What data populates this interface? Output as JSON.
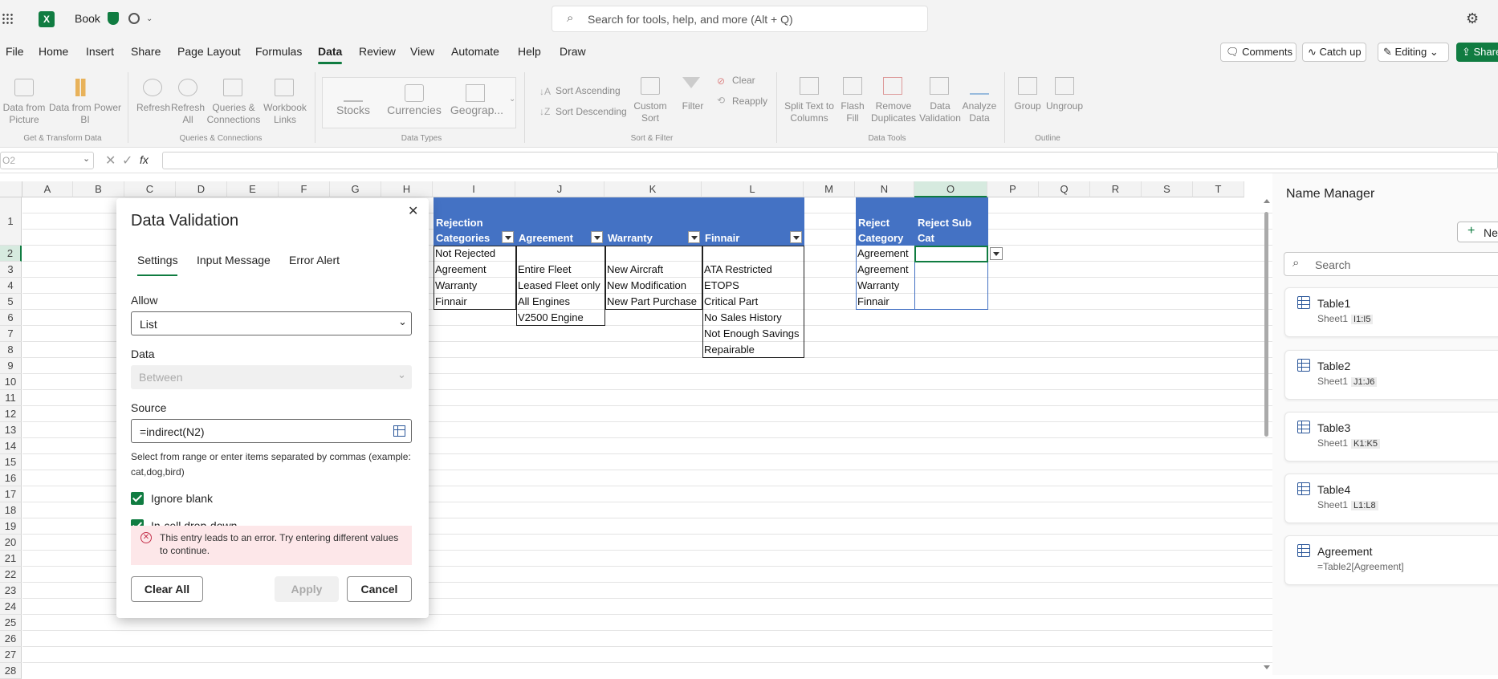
{
  "app": {
    "doc_title": "Book",
    "search_placeholder": "Search for tools, help, and more (Alt + Q)"
  },
  "menu": {
    "items": [
      "File",
      "Home",
      "Insert",
      "Share",
      "Page Layout",
      "Formulas",
      "Data",
      "Review",
      "View",
      "Automate",
      "Help",
      "Draw"
    ],
    "active": "Data",
    "comments": "Comments",
    "catchup": "Catch up",
    "editing": "Editing",
    "share": "Share"
  },
  "ribbon": {
    "get_transform": {
      "b1": "Data from\nPicture",
      "b2": "Data from Power\nBI",
      "label": "Get & Transform Data"
    },
    "queries": {
      "b1": "Refresh",
      "b2": "Refresh\nAll",
      "b3": "Queries &\nConnections",
      "b4": "Workbook\nLinks",
      "label": "Queries & Connections"
    },
    "data_types": {
      "b1": "Stocks",
      "b2": "Currencies",
      "b3": "Geograp...",
      "label": "Data Types"
    },
    "sort_filter": {
      "asc": "Sort Ascending",
      "desc": "Sort Descending",
      "custom": "Custom\nSort",
      "filter": "Filter",
      "clear": "Clear",
      "reapply": "Reapply",
      "label": "Sort & Filter"
    },
    "data_tools": {
      "b1": "Split Text to\nColumns",
      "b2": "Flash\nFill",
      "b3": "Remove\nDuplicates",
      "b4": "Data\nValidation",
      "b5": "Analyze\nData",
      "label": "Data Tools"
    },
    "outline": {
      "b1": "Group",
      "b2": "Ungroup",
      "label": "Outline"
    }
  },
  "formula_bar": {
    "name_box": "O2",
    "fx": "fx",
    "value": ""
  },
  "grid": {
    "columns": [
      "A",
      "B",
      "C",
      "D",
      "E",
      "F",
      "G",
      "H",
      "I",
      "J",
      "K",
      "L",
      "M",
      "N",
      "O",
      "P",
      "Q",
      "R",
      "S",
      "T"
    ],
    "rows": [
      "1",
      "2",
      "3",
      "4",
      "5",
      "6",
      "7",
      "8",
      "9",
      "10",
      "11",
      "12",
      "13",
      "14",
      "15",
      "16",
      "17",
      "18",
      "19",
      "20",
      "21",
      "22",
      "23",
      "24",
      "25",
      "26",
      "27",
      "28"
    ],
    "table_headers": {
      "I": "Rejection\nCategories",
      "J": "Agreement",
      "K": "Warranty",
      "L": "Finnair",
      "N": "Reject\nCategory",
      "O": "Reject Sub\nCat"
    },
    "col_I": [
      "Not Rejected",
      "Agreement",
      "Warranty",
      "Finnair"
    ],
    "col_J": [
      "",
      "Entire Fleet",
      "Leased Fleet only",
      "All Engines",
      "V2500 Engine"
    ],
    "col_K": [
      "",
      "New Aircraft",
      "New Modification",
      "New Part Purchase"
    ],
    "col_L": [
      "",
      "ATA Restricted",
      "ETOPS",
      "Critical Part",
      "No Sales History",
      "Not Enough Savings",
      "Repairable"
    ],
    "col_N": [
      "Agreement",
      "Agreement",
      "Warranty",
      "Finnair"
    ]
  },
  "dialog": {
    "title": "Data Validation",
    "tabs": [
      "Settings",
      "Input Message",
      "Error Alert"
    ],
    "allow_label": "Allow",
    "allow_value": "List",
    "data_label": "Data",
    "data_value": "Between",
    "source_label": "Source",
    "source_value": "=indirect(N2)",
    "hint": "Select from range or enter items separated by commas (example: cat,dog,bird)",
    "ignore_blank": "Ignore blank",
    "in_cell": "In-cell drop-down",
    "error": "This entry leads to an error. Try entering different values to continue.",
    "clear_all": "Clear All",
    "apply": "Apply",
    "cancel": "Cancel"
  },
  "name_manager": {
    "title": "Name Manager",
    "new_label": "New",
    "search_placeholder": "Search",
    "items": [
      {
        "name": "Table1",
        "sheet": "Sheet1",
        "ref": "I1:I5"
      },
      {
        "name": "Table2",
        "sheet": "Sheet1",
        "ref": "J1:J6"
      },
      {
        "name": "Table3",
        "sheet": "Sheet1",
        "ref": "K1:K5"
      },
      {
        "name": "Table4",
        "sheet": "Sheet1",
        "ref": "L1:L8"
      },
      {
        "name": "Agreement",
        "formula": "=Table2[Agreement]"
      }
    ]
  },
  "colors": {
    "excel_green": "#107c41",
    "table_blue": "#4472c4",
    "error_bg": "#fde7e9"
  }
}
